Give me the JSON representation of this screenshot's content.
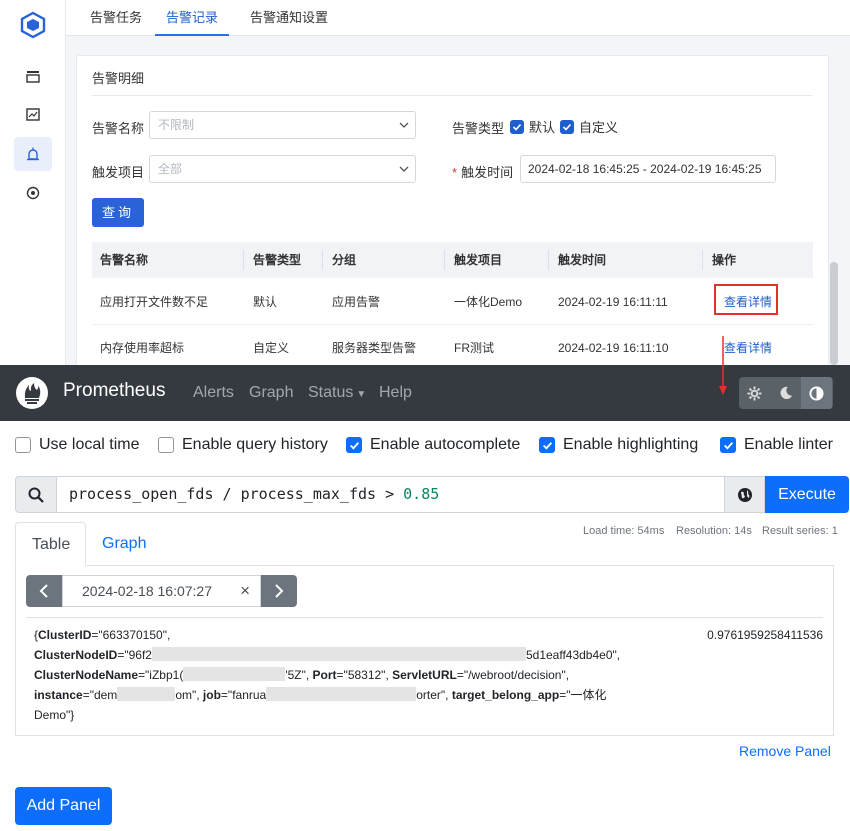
{
  "top_app": {
    "tabs": [
      "告警任务",
      "告警记录",
      "告警通知设置"
    ],
    "active_tab": "告警记录",
    "card_title": "告警明细",
    "filters": {
      "name_label": "告警名称",
      "name_placeholder": "不限制",
      "type_label": "告警类型",
      "type_options": [
        "默认",
        "自定义"
      ],
      "project_label": "触发项目",
      "project_placeholder": "全部",
      "time_label": "触发时间",
      "time_range": "2024-02-18 16:45:25 - 2024-02-19 16:45:25"
    },
    "query_button": "查询",
    "table": {
      "headers": [
        "告警名称",
        "告警类型",
        "分组",
        "触发项目",
        "触发时间",
        "操作"
      ],
      "rows": [
        [
          "应用打开文件数不足",
          "默认",
          "应用告警",
          "一体化Demo",
          "2024-02-19 16:11:11",
          "查看详情"
        ],
        [
          "内存使用率超标",
          "自定义",
          "服务器类型告警",
          "FR测试",
          "2024-02-19 16:11:10",
          "查看详情"
        ]
      ]
    },
    "accent_color": "#1f5fcc",
    "highlight_color": "#e0322d"
  },
  "prometheus": {
    "brand": "Prometheus",
    "nav": [
      "Alerts",
      "Graph",
      "Status",
      "Help"
    ],
    "options": {
      "local_time": "Use local time",
      "query_history": "Enable query history",
      "autocomplete": "Enable autocomplete",
      "highlighting": "Enable highlighting",
      "linter": "Enable linter"
    },
    "expression": {
      "text": "process_open_fds / process_max_fds > ",
      "number": "0.85"
    },
    "execute_label": "Execute",
    "stats": {
      "load_time": "Load time: 54ms",
      "resolution": "Resolution: 14s",
      "result_series": "Result series: 1"
    },
    "tabs": {
      "table": "Table",
      "graph": "Graph"
    },
    "eval_time": "2024-02-18 16:07:27",
    "result": {
      "cluster_id_key": "ClusterID",
      "cluster_id_val": "\"663370150\"",
      "node_id_key": "ClusterNodeID",
      "node_id_prefix": "=\"96f2",
      "node_id_suffix": "5d1eaff43db4e0\"",
      "node_name_key": "ClusterNodeName",
      "node_name_prefix": "=\"iZbp1(",
      "node_name_suffix": "'5Z\"",
      "port_key": "Port",
      "port_val": "=\"58312\"",
      "servlet_key": "ServletURL",
      "servlet_val": "=\"/webroot/decision\"",
      "instance_key": "instance",
      "instance_prefix": "=\"dem",
      "instance_suffix": "om\"",
      "job_key": "job",
      "job_prefix": "=\"fanrua",
      "job_suffix": "orter\"",
      "app_key": "target_belong_app",
      "app_val_1": "=\"一体化",
      "app_val_2": "Demo\"}",
      "value": "0.9761959258411536"
    },
    "remove_panel": "Remove Panel",
    "add_panel": "Add Panel",
    "primary_color": "#0d6efd",
    "navbar_color": "#343a40"
  }
}
